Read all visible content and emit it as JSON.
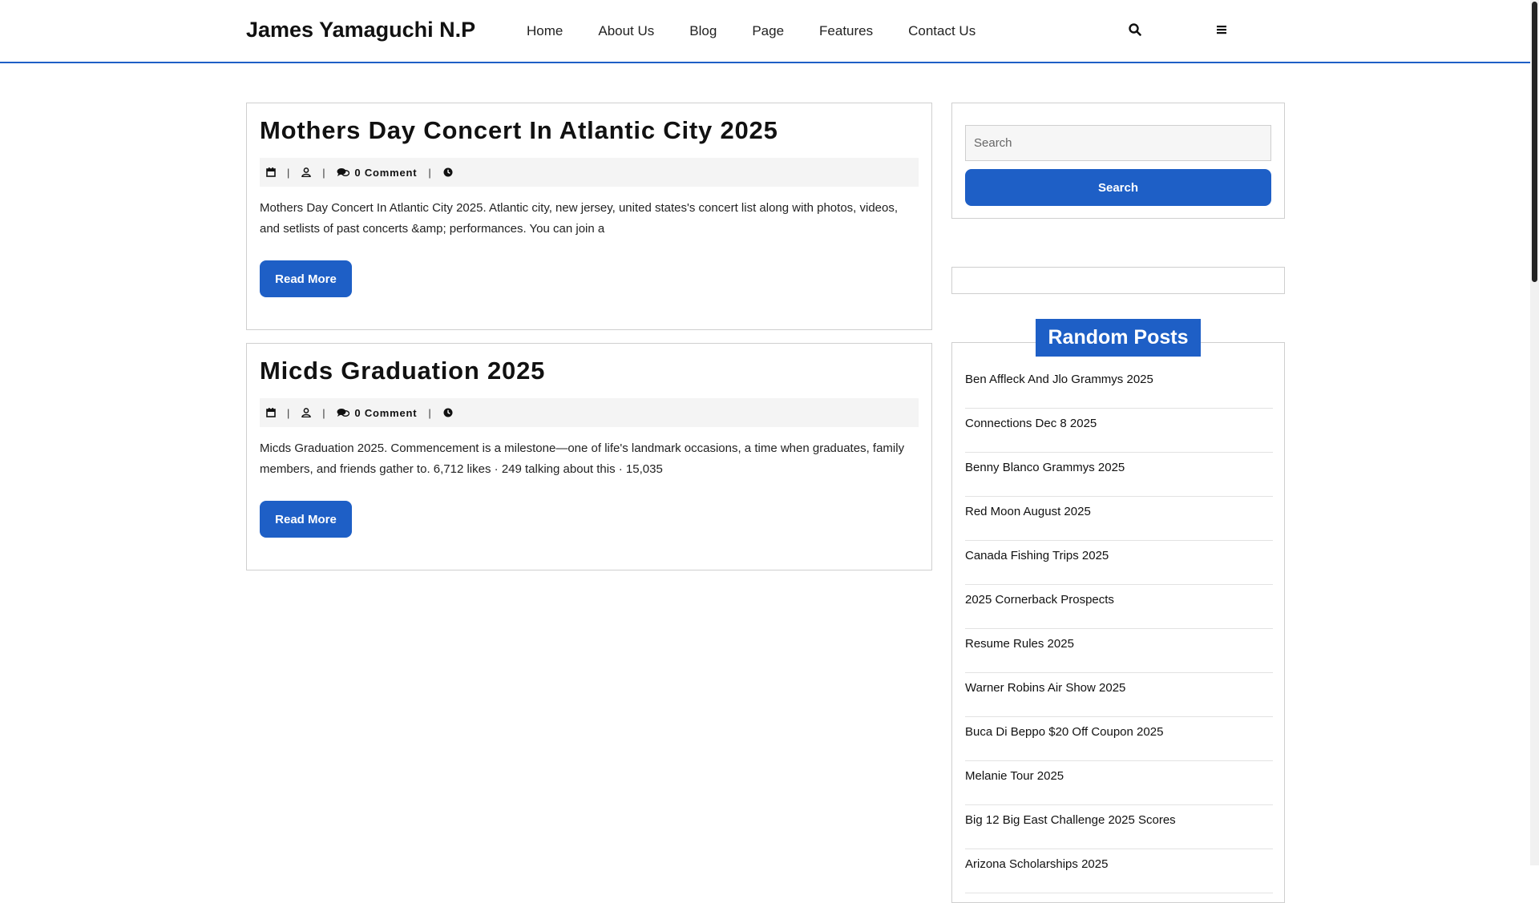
{
  "header": {
    "site_title": "James Yamaguchi N.P",
    "nav": [
      "Home",
      "About Us",
      "Blog",
      "Page",
      "Features",
      "Contact Us"
    ],
    "icons": [
      "search-icon",
      "menu-icon"
    ]
  },
  "posts": [
    {
      "title": "Mothers Day Concert In Atlantic City 2025",
      "comments": "0 Comment",
      "excerpt": "Mothers Day Concert In Atlantic City 2025. Atlantic city, new jersey, united states's concert list along with photos, videos, and setlists of past concerts &amp; performances. You can join a",
      "read_more": "Read More"
    },
    {
      "title": "Micds Graduation 2025",
      "comments": "0 Comment",
      "excerpt": "Micds Graduation 2025. Commencement is a milestone—one of life's landmark occasions, a time when graduates, family members, and friends gather to. 6,712 likes · 249 talking about this · 15,035",
      "read_more": "Read More"
    }
  ],
  "sidebar": {
    "search_placeholder": "Search",
    "search_button": "Search",
    "random_posts_heading": "Random Posts",
    "random_posts": [
      "Ben Affleck And Jlo Grammys 2025",
      "Connections Dec 8 2025",
      "Benny Blanco Grammys 2025",
      "Red Moon August 2025",
      "Canada Fishing Trips 2025",
      "2025 Cornerback Prospects",
      "Resume Rules 2025",
      "Warner Robins Air Show 2025",
      "Buca Di Beppo $20 Off Coupon 2025",
      "Melanie Tour 2025",
      "Big 12 Big East Challenge 2025 Scores",
      "Arizona Scholarships 2025"
    ]
  },
  "colors": {
    "accent": "#1e5fc6",
    "meta_bg": "#f4f4f4",
    "border": "#cfcfcf"
  }
}
